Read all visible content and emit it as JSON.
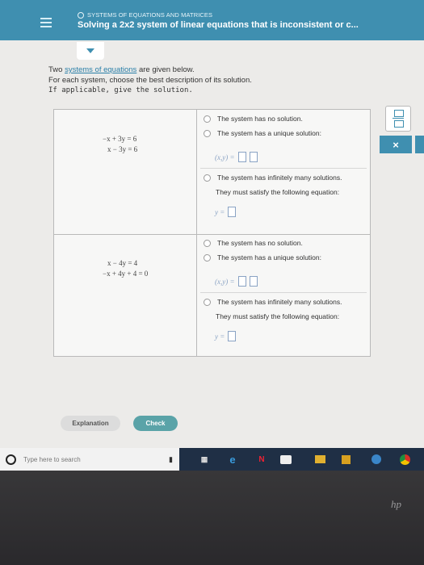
{
  "header": {
    "topic": "SYSTEMS OF EQUATIONS AND MATRICES",
    "title": "Solving a 2x2 system of linear equations that is inconsistent or c..."
  },
  "intro": {
    "line1_prefix": "Two ",
    "line1_link": "systems of equations",
    "line1_suffix": " are given below.",
    "line2": "For each system, choose the best description of its solution.",
    "line3": "If applicable, give the solution."
  },
  "systems": [
    {
      "eq1": "−x + 3y = 6",
      "eq2": "x − 3y = 6",
      "opt_no_solution": "The system has no solution.",
      "opt_unique": "The system has a unique solution:",
      "unique_prefix": "(x,y) = ",
      "opt_infinite": "The system has infinitely many solutions.",
      "opt_infinite_sub": "They must satisfy the following equation:",
      "infinite_prefix": "y = "
    },
    {
      "eq1": "x − 4y = 4",
      "eq2": "−x + 4y + 4 = 0",
      "opt_no_solution": "The system has no solution.",
      "opt_unique": "The system has a unique solution:",
      "unique_prefix": "(x,y) = ",
      "opt_infinite": "The system has infinitely many solutions.",
      "opt_infinite_sub": "They must satisfy the following equation:",
      "infinite_prefix": "y = "
    }
  ],
  "buttons": {
    "explanation": "Explanation",
    "check": "Check"
  },
  "side": {
    "close_glyph": "×"
  },
  "taskbar": {
    "search_placeholder": "Type here to search"
  },
  "bezel": {
    "logo": "hp"
  },
  "colors": {
    "header": "#3f8fb0",
    "check_button": "#5aa3a8",
    "link": "#2a7fa8"
  }
}
